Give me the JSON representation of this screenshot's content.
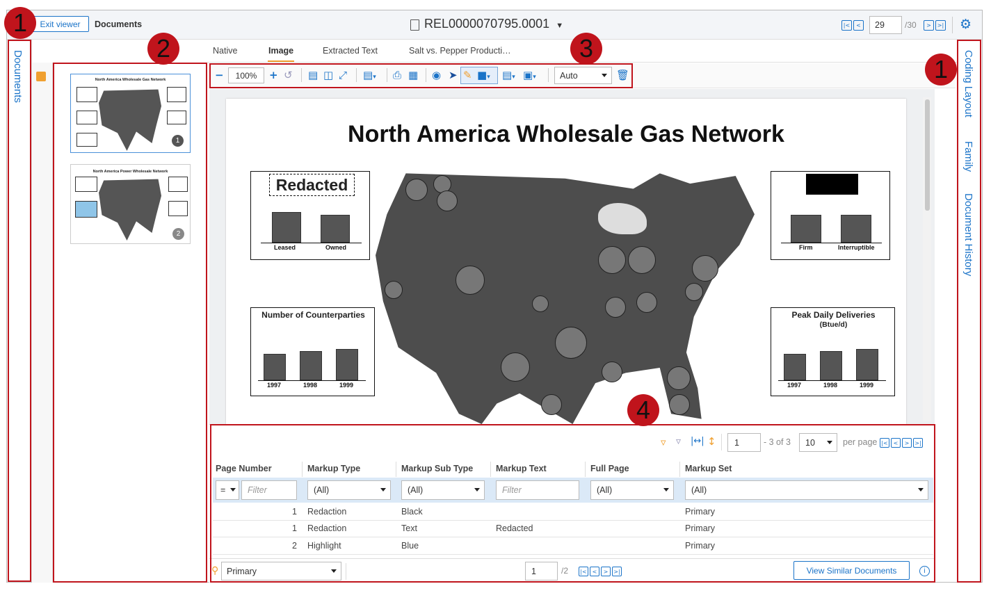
{
  "header": {
    "exit_label": "Exit viewer",
    "documents_label": "Documents",
    "doc_id": "REL0000070795.0001",
    "page_current": "29",
    "page_total": "/30"
  },
  "left_rail": {
    "label": "Documents"
  },
  "right_rail": {
    "items": [
      "Coding Layout",
      "Family",
      "Document History"
    ]
  },
  "tabs": [
    "Native",
    "Image",
    "Extracted Text",
    "Salt vs. Pepper Producti…"
  ],
  "active_tab": "Image",
  "toolbar": {
    "zoom": "100%",
    "mode": "Auto"
  },
  "thumbnails": [
    {
      "title": "North America Wholesale Gas Network",
      "page": "1"
    },
    {
      "title": "North America Power Wholesale Network",
      "page": "2"
    }
  ],
  "document": {
    "title": "North America Wholesale Gas Network",
    "box_tl": {
      "label": "Redacted",
      "cats": [
        "Leased",
        "Owned"
      ]
    },
    "box_tr": {
      "cats": [
        "Firm",
        "Interruptible"
      ]
    },
    "box_bl": {
      "title": "Number of Counterparties",
      "cats": [
        "1997",
        "1998",
        "1999"
      ]
    },
    "box_br": {
      "title": "Peak Daily Deliveries",
      "subtitle": "(Btue/d)",
      "cats": [
        "1997",
        "1998",
        "1999"
      ]
    }
  },
  "markup_grid": {
    "page_input": "1",
    "range_text": "- 3 of 3",
    "per_page_value": "10",
    "per_page_label": "per page",
    "columns": [
      "Page Number",
      "Markup Type",
      "Markup Sub Type",
      "Markup Text",
      "Full Page",
      "Markup Set"
    ],
    "filters": {
      "op": "=",
      "filter_placeholder": "Filter",
      "all": "(All)"
    },
    "rows": [
      {
        "page": "1",
        "type": "Redaction",
        "sub": "Black",
        "text": "",
        "full": "",
        "set": "Primary"
      },
      {
        "page": "1",
        "type": "Redaction",
        "sub": "Text",
        "text": "Redacted",
        "full": "",
        "set": "Primary"
      },
      {
        "page": "2",
        "type": "Highlight",
        "sub": "Blue",
        "text": "",
        "full": "",
        "set": "Primary"
      }
    ],
    "markup_set_select": "Primary",
    "footer_page": "1",
    "footer_total": "/2",
    "view_similar": "View Similar Documents"
  },
  "callouts": [
    "1",
    "2",
    "3",
    "1",
    "4"
  ],
  "colors": {
    "accent": "#1a73c8",
    "callout": "#c0141c",
    "highlight_tab": "#f0a030"
  }
}
